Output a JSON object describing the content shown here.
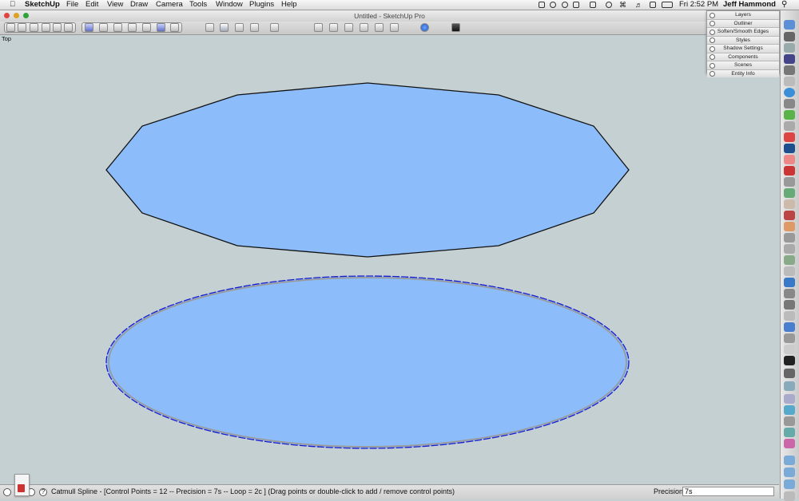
{
  "menubar": {
    "app": "SketchUp",
    "items": [
      "File",
      "Edit",
      "View",
      "Draw",
      "Camera",
      "Tools",
      "Window",
      "Plugins",
      "Help"
    ],
    "clock": "Fri 2:52 PM",
    "user": "Jeff Hammond"
  },
  "window": {
    "title": "Untitled - SketchUp Pro"
  },
  "viewport": {
    "view_name": "Top"
  },
  "tray": {
    "panels": [
      "Layers",
      "Outliner",
      "Soften/Smooth Edges",
      "Styles",
      "Shadow Settings",
      "Components",
      "Scenes",
      "Entity Info"
    ]
  },
  "statusbar": {
    "message": "Catmull Spline - [Control Points = 12  -- Precision = 7s  -- Loop = 2c ]   (Drag points or double-click to add / remove control points)",
    "precision_label": "Precision",
    "precision_value": "7s",
    "help_glyph": "?"
  },
  "colors": {
    "shape_fill": "#8cbcfa",
    "shape_edge": "#111111",
    "spline_blue": "#1a1acc",
    "spline_grey": "#9a9a9a",
    "background": "#c5d0d3"
  },
  "icons": {
    "toolbar": [
      "select-icon",
      "paint-icon",
      "home-icon",
      "views-icon",
      "orbit-icon",
      "pan-icon",
      "zoom-icon",
      "info-icon"
    ],
    "dock": [
      "finder-icon",
      "dashboard-icon",
      "mail-icon",
      "safari-icon",
      "itunes-icon",
      "photoshop-icon",
      "terminal-icon",
      "folder-icon",
      "trash-icon"
    ]
  }
}
